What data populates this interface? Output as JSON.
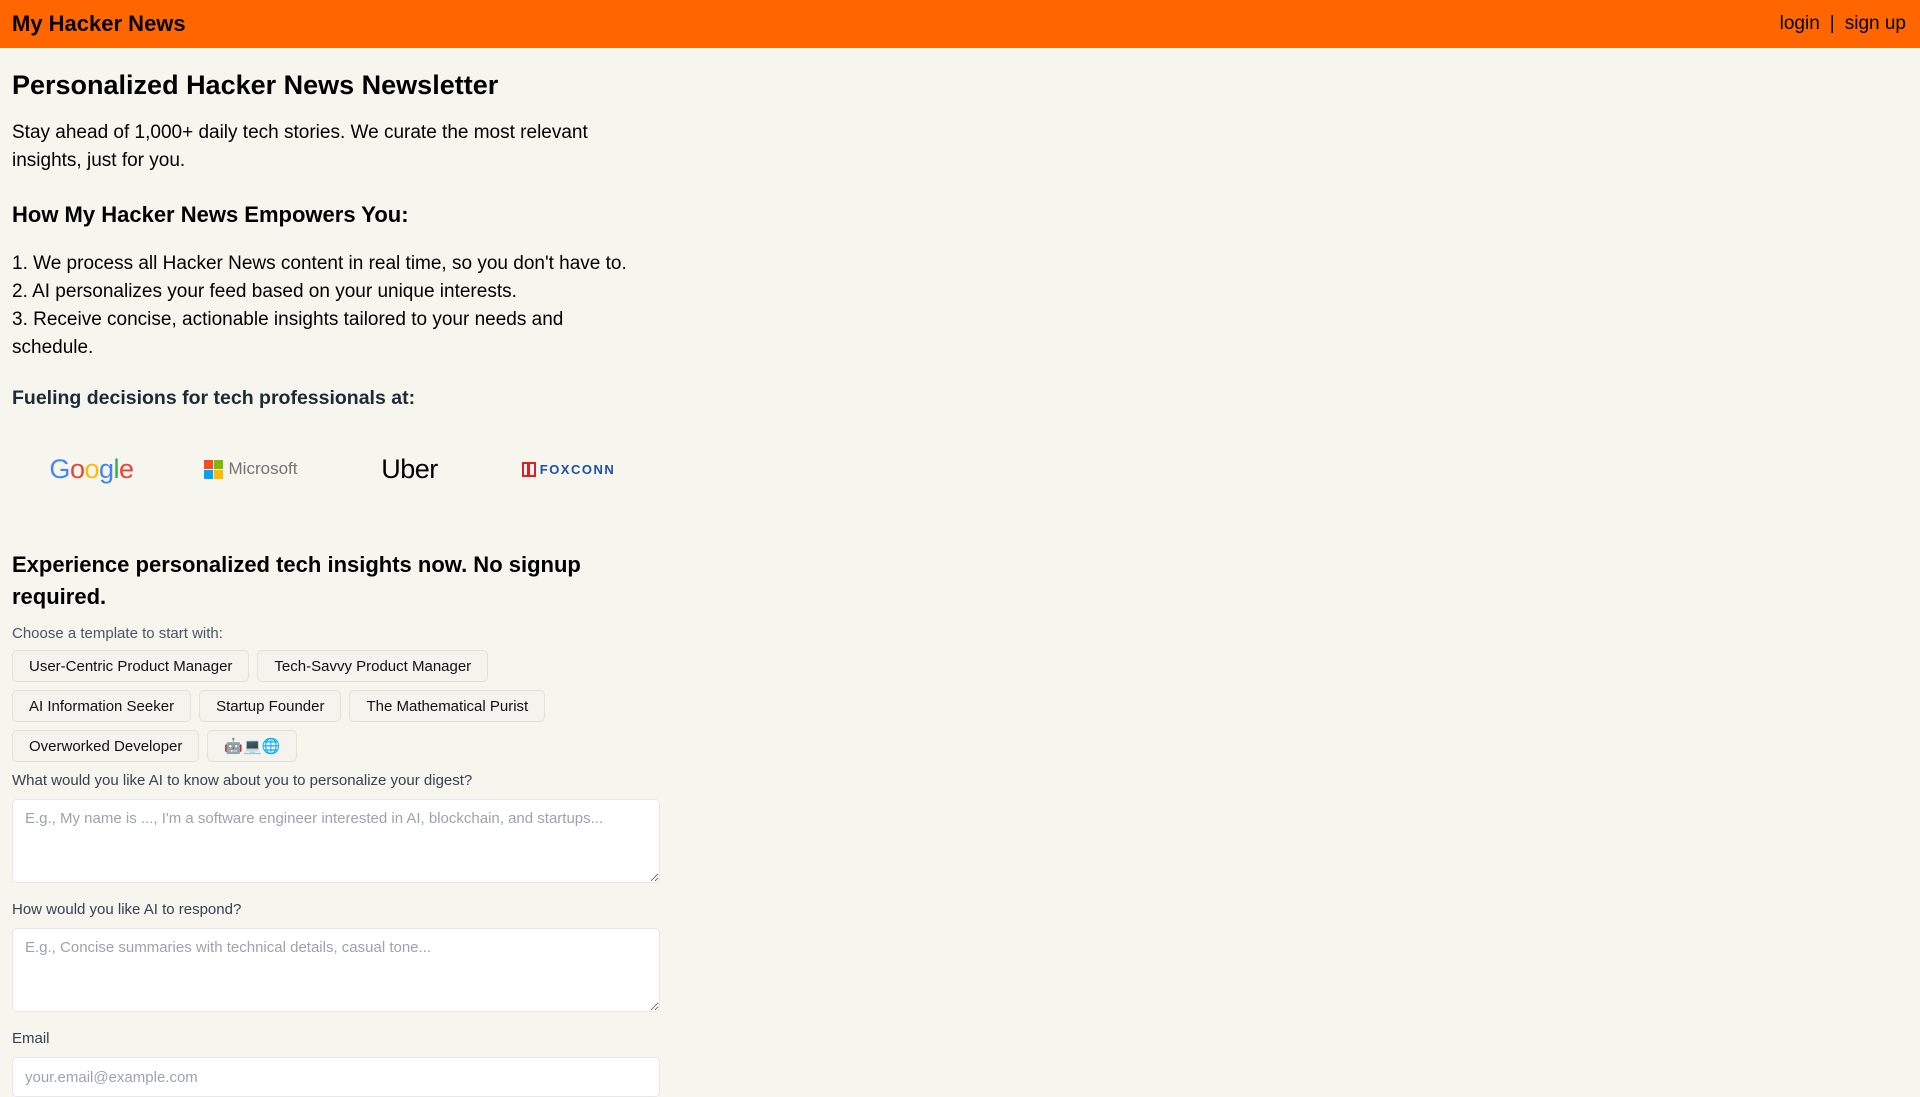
{
  "header": {
    "brand": "My Hacker News",
    "login": "login",
    "separator": "|",
    "signup": "sign up",
    "accent_color": "#ff6600"
  },
  "hero": {
    "title": "Personalized Hacker News Newsletter",
    "intro": "Stay ahead of 1,000+ daily tech stories. We curate the most relevant insights, just for you."
  },
  "empowers": {
    "heading": "How My Hacker News Empowers You:",
    "steps": [
      "1. We process all Hacker News content in real time, so you don't have to.",
      "2. AI personalizes your feed based on your unique interests.",
      "3. Receive concise, actionable insights tailored to your needs and schedule."
    ]
  },
  "companies": {
    "heading": "Fueling decisions for tech professionals at:",
    "logos": [
      "Google",
      "Microsoft",
      "Uber",
      "FOXCONN"
    ]
  },
  "trial": {
    "heading": "Experience personalized tech insights now. No signup required.",
    "choose_label": "Choose a template to start with:",
    "templates": [
      "User-Centric Product Manager",
      "Tech-Savvy Product Manager",
      "AI Information Seeker",
      "Startup Founder",
      "The Mathematical Purist",
      "Overworked Developer",
      "🤖💻🌐"
    ]
  },
  "form": {
    "about_label": "What would you like AI to know about you to personalize your digest?",
    "about_placeholder": "E.g., My name is ..., I'm a software engineer interested in AI, blockchain, and startups...",
    "respond_label": "How would you like AI to respond?",
    "respond_placeholder": "E.g., Concise summaries with technical details, casual tone...",
    "email_label": "Email",
    "email_placeholder": "your.email@example.com"
  }
}
